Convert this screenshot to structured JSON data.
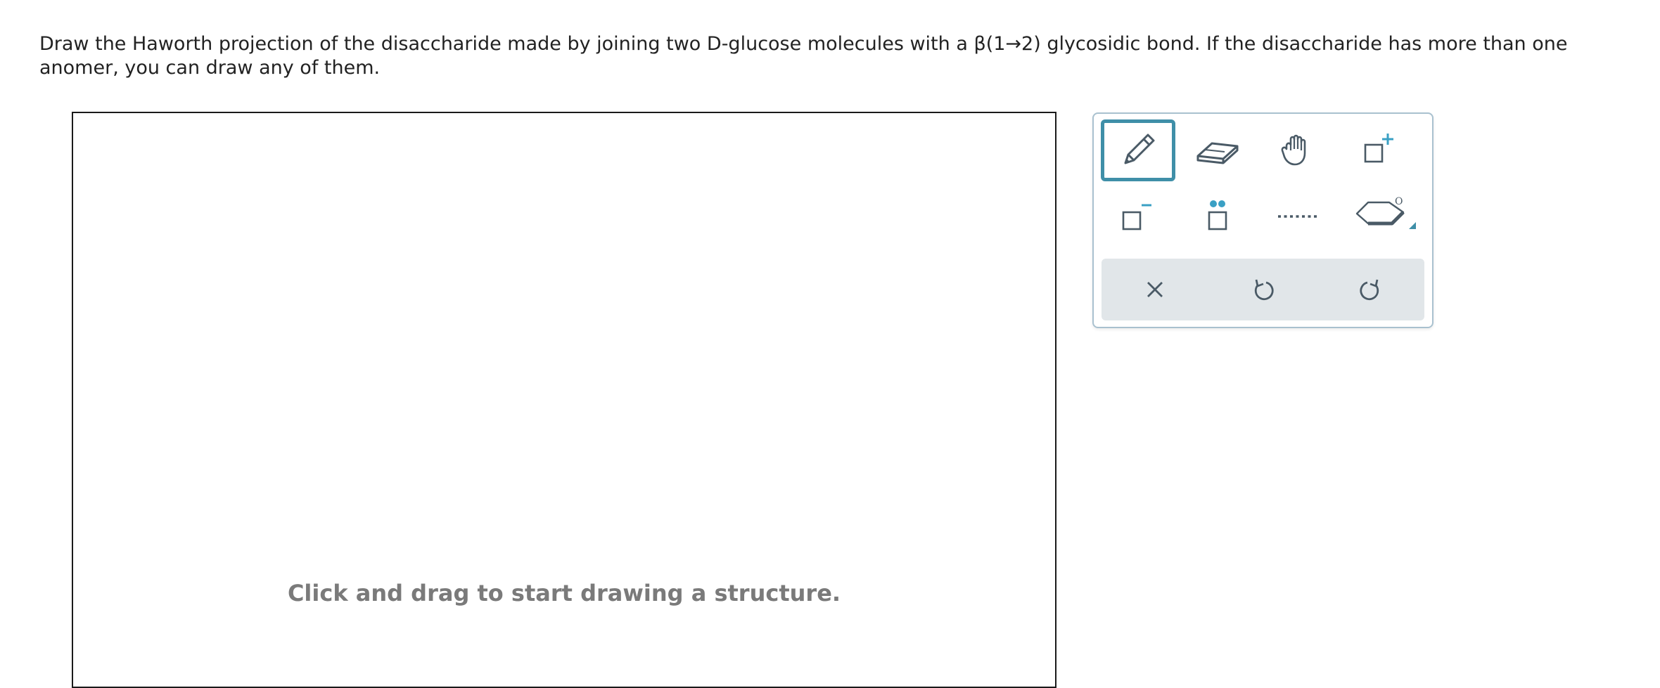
{
  "question": {
    "text": "Draw the Haworth projection of the disaccharide made by joining two D-glucose molecules with a β(1→2) glycosidic bond. If the disaccharide has more than one anomer, you can draw any of them."
  },
  "canvas": {
    "hint": "Click and drag to start drawing a structure."
  },
  "palette": {
    "tools": [
      {
        "name": "pencil-tool",
        "icon": "pencil-icon",
        "selected": true
      },
      {
        "name": "eraser-tool",
        "icon": "eraser-icon",
        "selected": false
      },
      {
        "name": "hand-tool",
        "icon": "hand-icon",
        "selected": false
      },
      {
        "name": "positive-charge-tool",
        "icon": "positive-charge-icon",
        "label": "+",
        "selected": false
      },
      {
        "name": "negative-charge-tool",
        "icon": "negative-charge-icon",
        "label": "−",
        "selected": false
      },
      {
        "name": "lone-pair-tool",
        "icon": "lone-pair-icon",
        "selected": false
      },
      {
        "name": "dashed-bond-tool",
        "icon": "dashed-line-icon",
        "selected": false
      },
      {
        "name": "ring-template-tool",
        "icon": "pyranose-ring-icon",
        "label": "O",
        "selected": false
      }
    ],
    "actions": [
      {
        "name": "clear-button",
        "icon": "close-icon"
      },
      {
        "name": "undo-button",
        "icon": "undo-icon"
      },
      {
        "name": "redo-button",
        "icon": "redo-icon"
      }
    ]
  },
  "colors": {
    "accent": "#3f8fa8",
    "icon": "#4a5a66",
    "plus_accent": "#3aa0c4",
    "action_bar": "#e1e6e9",
    "hint": "#7a7a7a"
  }
}
